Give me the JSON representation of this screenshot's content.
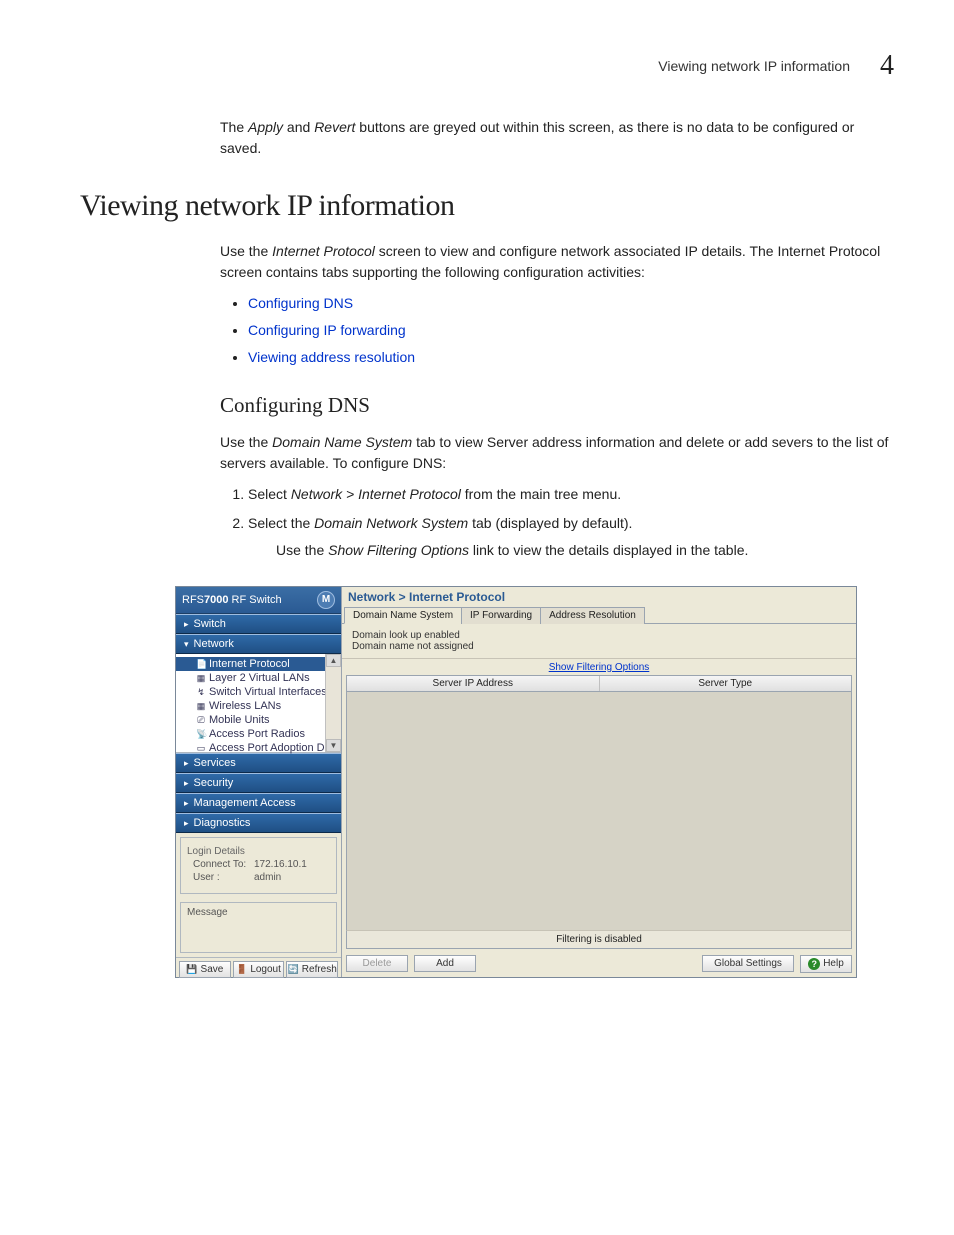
{
  "header": {
    "title": "Viewing network IP information",
    "chapter": "4"
  },
  "intro": {
    "pre": "The ",
    "i1": "Apply",
    "mid": " and ",
    "i2": "Revert",
    "post": " buttons are greyed out within this screen, as there is no data to be configured or saved."
  },
  "h1": "Viewing network IP information",
  "p1": {
    "pre": "Use the ",
    "i": "Internet Protocol",
    "post": " screen to view and configure network associated IP details. The Internet Protocol screen contains tabs supporting the following configuration activities:"
  },
  "bullets": [
    "Configuring DNS",
    "Configuring IP forwarding",
    "Viewing address resolution"
  ],
  "h2": "Configuring DNS",
  "p2": {
    "pre": "Use the ",
    "i": "Domain Name System",
    "post": " tab to view Server address information and delete or add severs to the list of servers available. To configure DNS:"
  },
  "steps": {
    "s1": {
      "pre": "Select ",
      "i": "Network > Internet Protocol",
      "post": " from the main tree menu."
    },
    "s2": {
      "pre": "Select the ",
      "i": "Domain Network System",
      "post": " tab (displayed by default)."
    },
    "s2sub": {
      "pre": "Use the ",
      "i": "Show Filtering Options",
      "post": " link to view the details displayed in the table."
    }
  },
  "app": {
    "sidebar": {
      "product_prefix": "RFS",
      "product_bold": "7000",
      "product_suffix": " RF Switch",
      "sections": {
        "switch": "Switch",
        "network": "Network",
        "services": "Services",
        "security": "Security",
        "mgmt": "Management Access",
        "diag": "Diagnostics"
      },
      "tree": [
        "Internet Protocol",
        "Layer 2 Virtual LANs",
        "Switch Virtual Interfaces",
        "Wireless LANs",
        "Mobile Units",
        "Access Port Radios",
        "Access Port Adoption Defaults"
      ],
      "login": {
        "legend": "Login Details",
        "connect_k": "Connect To:",
        "connect_v": "172.16.10.1",
        "user_k": "User :",
        "user_v": "admin"
      },
      "message_legend": "Message",
      "footer": {
        "save": "Save",
        "logout": "Logout",
        "refresh": "Refresh"
      }
    },
    "main": {
      "breadcrumb": "Network > Internet Protocol",
      "tabs": [
        "Domain Name System",
        "IP Forwarding",
        "Address Resolution"
      ],
      "status1": "Domain look up enabled",
      "status2": "Domain name not assigned",
      "filter_link": "Show Filtering Options",
      "cols": [
        "Server IP Address",
        "Server Type"
      ],
      "filter_status": "Filtering is disabled",
      "buttons": {
        "delete": "Delete",
        "add": "Add",
        "global": "Global Settings",
        "help": "Help"
      }
    }
  }
}
